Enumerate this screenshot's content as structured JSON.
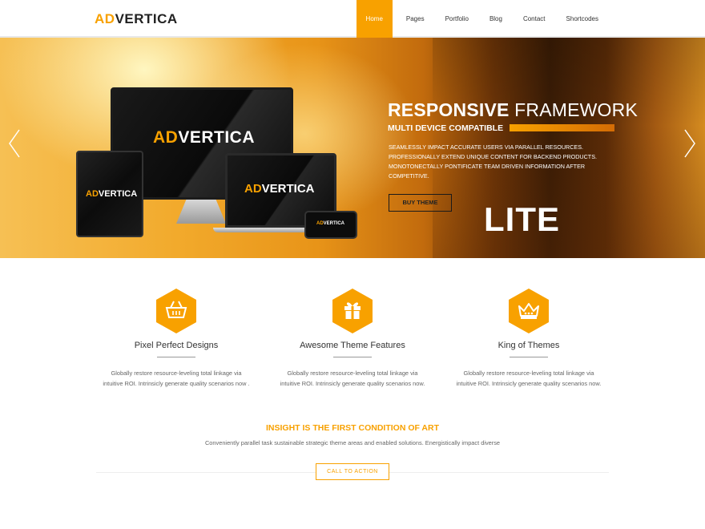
{
  "header": {
    "logo_accent": "AD",
    "logo_rest": "VERTICA",
    "nav": [
      {
        "label": "Home"
      },
      {
        "label": "Pages"
      },
      {
        "label": "Portfolio"
      },
      {
        "label": "Blog"
      },
      {
        "label": "Contact"
      },
      {
        "label": "Shortcodes"
      }
    ]
  },
  "hero": {
    "title_bold": "RESPONSIVE",
    "title_light": "FRAMEWORK",
    "subtitle": "MULTI DEVICE COMPATIBLE",
    "description": "Seamlessly impact accurate users via parallel resources. Professionally extend unique content for backend products. Monotonectally pontificate team driven information after competitive.",
    "button": "BUY THEME",
    "badge": "LITE",
    "device_logo_accent": "AD",
    "device_logo_rest": "VERTICA"
  },
  "features": [
    {
      "icon": "basket-icon",
      "title": "Pixel Perfect Designs",
      "text": "Globally restore resource-leveling total linkage via intuitive ROI. Intrinsicly generate quality scenarios now ."
    },
    {
      "icon": "gift-icon",
      "title": "Awesome Theme Features",
      "text": "Globally restore resource-leveling total linkage via intuitive ROI. Intrinsicly generate quality scenarios now."
    },
    {
      "icon": "crown-icon",
      "title": "King of Themes",
      "text": "Globally restore resource-leveling total linkage via intuitive ROI. Intrinsicly generate quality scenarios now."
    }
  ],
  "cta": {
    "heading": "INSIGHT IS THE FIRST CONDITION OF ART",
    "sub": "Conveniently parallel task sustainable strategic theme areas and enabled solutions. Energistically impact diverse",
    "button": "CALL TO ACTION"
  },
  "colors": {
    "accent": "#f8a100"
  }
}
